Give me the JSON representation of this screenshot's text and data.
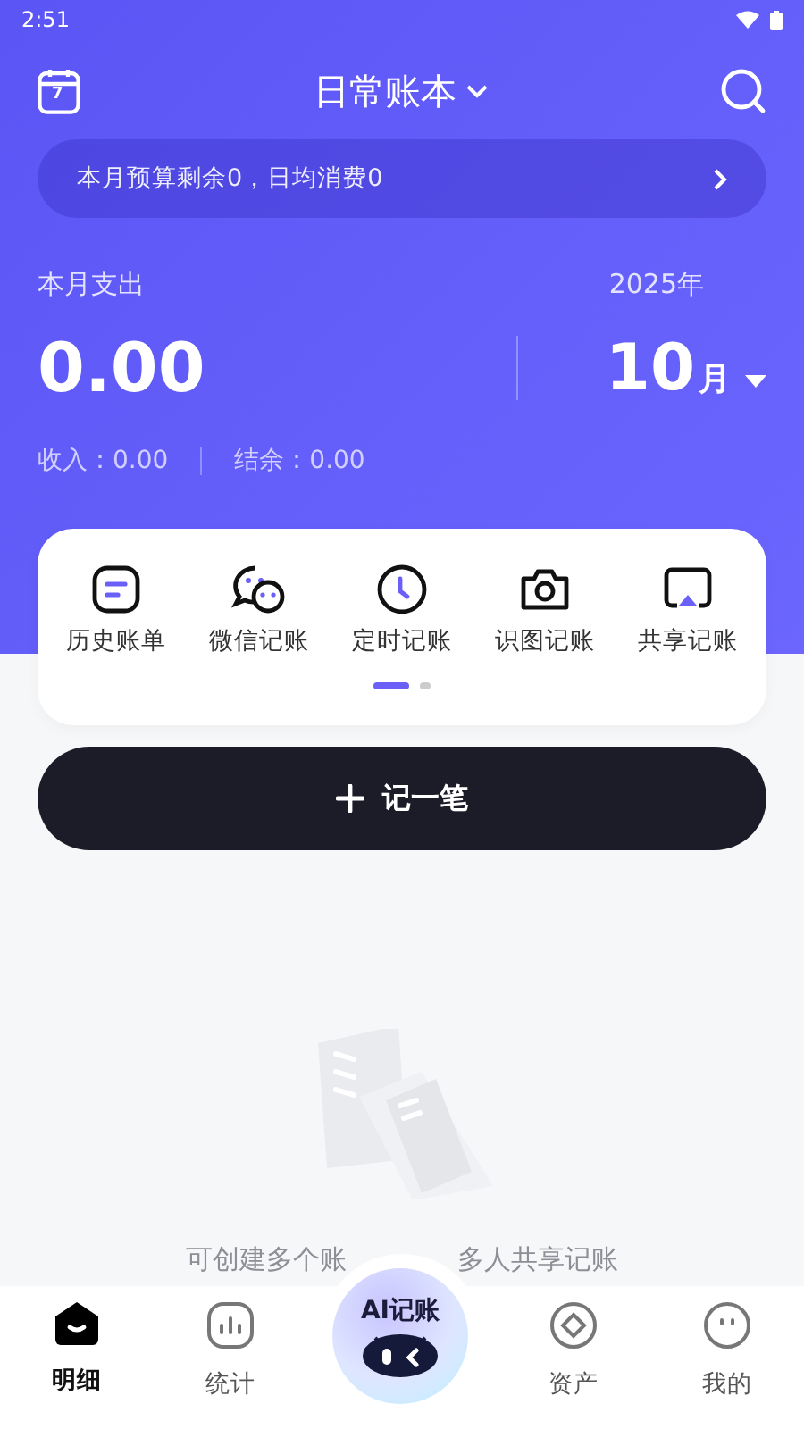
{
  "status_bar": {
    "time": "2:51"
  },
  "header": {
    "title": "日常账本",
    "calendar_day": "7"
  },
  "budget_banner": {
    "text": "本月预算剩余0，日均消费0"
  },
  "summary": {
    "label": "本月支出",
    "amount": "0.00",
    "year": "2025年",
    "month": "10",
    "month_unit": "月",
    "income": "收入：0.00",
    "balance": "结余：0.00"
  },
  "quick_actions": [
    {
      "kind": "history",
      "label": "历史账单"
    },
    {
      "kind": "wechat",
      "label": "微信记账"
    },
    {
      "kind": "timer",
      "label": "定时记账"
    },
    {
      "kind": "camera",
      "label": "识图记账"
    },
    {
      "kind": "share",
      "label": "共享记账"
    }
  ],
  "pager": [
    {
      "selected": true
    },
    {
      "selected": false
    }
  ],
  "add_button": {
    "label": "记一笔"
  },
  "empty_state": {
    "text_start": "可创建多个账",
    "text_end": "多人共享记账"
  },
  "tabs": [
    {
      "kind": "home",
      "label": "明细",
      "selected": true
    },
    {
      "kind": "stats",
      "label": "统计",
      "selected": false
    },
    {
      "kind": "ai",
      "label": "AI记账",
      "selected": false
    },
    {
      "kind": "assets",
      "label": "资产",
      "selected": false
    },
    {
      "kind": "me",
      "label": "我的",
      "selected": false
    }
  ]
}
